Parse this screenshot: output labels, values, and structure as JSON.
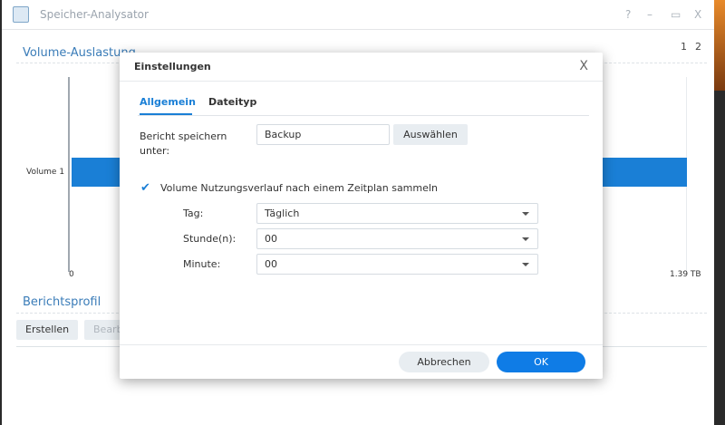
{
  "window": {
    "title": "Speicher-Analysator",
    "help": "?",
    "minimize": "–",
    "maximize": "▭",
    "close": "X"
  },
  "main": {
    "volume_section": "Volume-Auslastung",
    "pages": [
      "1",
      "2"
    ],
    "report_section": "Berichtsprofil",
    "buttons": {
      "create": "Erstellen",
      "edit": "Bearb"
    }
  },
  "chart_data": {
    "type": "bar",
    "orientation": "horizontal",
    "categories": [
      "Volume 1"
    ],
    "values": [
      1.39
    ],
    "xlim": [
      0,
      1.39
    ],
    "xtick_labels": [
      "0",
      "1.39 TB"
    ],
    "accent": "#1a7fd6"
  },
  "dialog": {
    "title": "Einstellungen",
    "close": "X",
    "tabs": [
      {
        "label": "Allgemein",
        "active": true
      },
      {
        "label": "Dateityp",
        "active": false
      }
    ],
    "save_label": "Bericht speichern unter:",
    "save_value": "Backup",
    "choose_button": "Auswählen",
    "collect_checkbox": {
      "checked": true,
      "label": "Volume Nutzungsverlauf nach einem Zeitplan sammeln"
    },
    "fields": [
      {
        "label": "Tag:",
        "value": "Täglich"
      },
      {
        "label": "Stunde(n):",
        "value": "00"
      },
      {
        "label": "Minute:",
        "value": "00"
      }
    ],
    "cancel": "Abbrechen",
    "ok": "OK"
  }
}
